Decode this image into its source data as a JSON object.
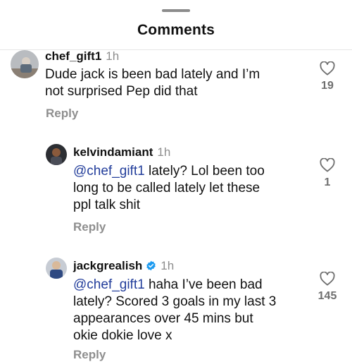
{
  "header": {
    "title": "Comments"
  },
  "comments": [
    {
      "username": "chef_gift1",
      "time": "1h",
      "verified": false,
      "mention": "",
      "text_lines": [
        "Dude jack is been bad lately and I’m",
        "not surprised Pep did that"
      ],
      "likes": "19",
      "reply_label": "Reply"
    },
    {
      "username": "kelvindamiant",
      "time": "1h",
      "verified": false,
      "mention": "@chef_gift1",
      "text_first": " lately? Lol been too",
      "text_lines": [
        "long to be called lately let these",
        "ppl talk shit"
      ],
      "likes": "1",
      "reply_label": "Reply"
    },
    {
      "username": "jackgrealish",
      "time": "1h",
      "verified": true,
      "mention": "@chef_gift1",
      "text_first": " haha I’ve been bad",
      "text_lines": [
        "lately? Scored 3 goals in my last 3",
        "appearances over 45 mins but",
        "okie dokie love x"
      ],
      "likes": "145",
      "reply_label": "Reply"
    }
  ],
  "colors": {
    "mention": "#233e9b",
    "muted": "#8e8e8e",
    "verified": "#1d9bf0"
  },
  "icons": [
    "heart-outline-icon",
    "verified-badge-icon",
    "avatar"
  ]
}
